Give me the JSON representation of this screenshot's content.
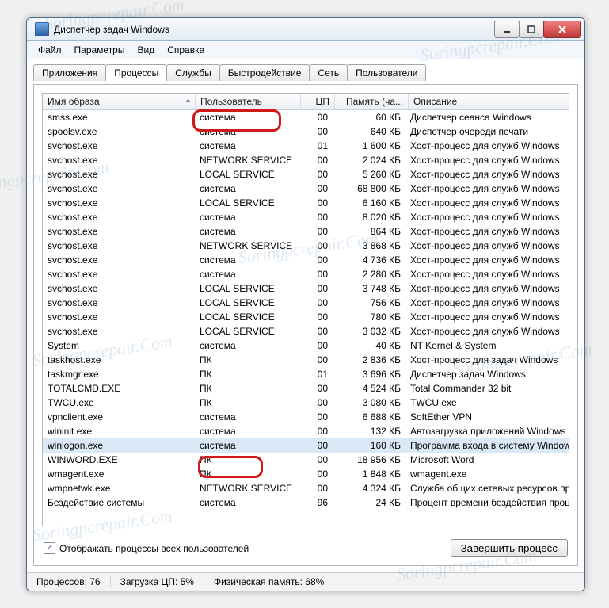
{
  "window": {
    "title": "Диспетчер задач Windows"
  },
  "menu": [
    "Файл",
    "Параметры",
    "Вид",
    "Справка"
  ],
  "tabs": [
    "Приложения",
    "Процессы",
    "Службы",
    "Быстродействие",
    "Сеть",
    "Пользователи"
  ],
  "active_tab": 1,
  "columns": [
    "Имя образа",
    "Пользователь",
    "ЦП",
    "Память (ча...",
    "Описание"
  ],
  "rows": [
    {
      "name": "smss.exe",
      "user": "система",
      "cpu": "00",
      "mem": "60 КБ",
      "desc": "Диспетчер сеанса  Windows"
    },
    {
      "name": "spoolsv.exe",
      "user": "система",
      "cpu": "00",
      "mem": "640 КБ",
      "desc": "Диспетчер очереди печати"
    },
    {
      "name": "svchost.exe",
      "user": "система",
      "cpu": "01",
      "mem": "1 600 КБ",
      "desc": "Хост-процесс для служб Windows"
    },
    {
      "name": "svchost.exe",
      "user": "NETWORK SERVICE",
      "cpu": "00",
      "mem": "2 024 КБ",
      "desc": "Хост-процесс для служб Windows"
    },
    {
      "name": "svchost.exe",
      "user": "LOCAL SERVICE",
      "cpu": "00",
      "mem": "5 260 КБ",
      "desc": "Хост-процесс для служб Windows"
    },
    {
      "name": "svchost.exe",
      "user": "система",
      "cpu": "00",
      "mem": "68 800 КБ",
      "desc": "Хост-процесс для служб Windows"
    },
    {
      "name": "svchost.exe",
      "user": "LOCAL SERVICE",
      "cpu": "00",
      "mem": "6 160 КБ",
      "desc": "Хост-процесс для служб Windows"
    },
    {
      "name": "svchost.exe",
      "user": "система",
      "cpu": "00",
      "mem": "8 020 КБ",
      "desc": "Хост-процесс для служб Windows"
    },
    {
      "name": "svchost.exe",
      "user": "система",
      "cpu": "00",
      "mem": "864 КБ",
      "desc": "Хост-процесс для служб Windows"
    },
    {
      "name": "svchost.exe",
      "user": "NETWORK SERVICE",
      "cpu": "00",
      "mem": "3 868 КБ",
      "desc": "Хост-процесс для служб Windows"
    },
    {
      "name": "svchost.exe",
      "user": "система",
      "cpu": "00",
      "mem": "4 736 КБ",
      "desc": "Хост-процесс для служб Windows"
    },
    {
      "name": "svchost.exe",
      "user": "система",
      "cpu": "00",
      "mem": "2 280 КБ",
      "desc": "Хост-процесс для служб Windows"
    },
    {
      "name": "svchost.exe",
      "user": "LOCAL SERVICE",
      "cpu": "00",
      "mem": "3 748 КБ",
      "desc": "Хост-процесс для служб Windows"
    },
    {
      "name": "svchost.exe",
      "user": "LOCAL SERVICE",
      "cpu": "00",
      "mem": "756 КБ",
      "desc": "Хост-процесс для служб Windows"
    },
    {
      "name": "svchost.exe",
      "user": "LOCAL SERVICE",
      "cpu": "00",
      "mem": "780 КБ",
      "desc": "Хост-процесс для служб Windows"
    },
    {
      "name": "svchost.exe",
      "user": "LOCAL SERVICE",
      "cpu": "00",
      "mem": "3 032 КБ",
      "desc": "Хост-процесс для служб Windows"
    },
    {
      "name": "System",
      "user": "система",
      "cpu": "00",
      "mem": "40 КБ",
      "desc": "NT Kernel & System"
    },
    {
      "name": "taskhost.exe",
      "user": "ПК",
      "cpu": "00",
      "mem": "2 836 КБ",
      "desc": "Хост-процесс для задач Windows"
    },
    {
      "name": "taskmgr.exe",
      "user": "ПК",
      "cpu": "01",
      "mem": "3 696 КБ",
      "desc": "Диспетчер задач Windows"
    },
    {
      "name": "TOTALCMD.EXE",
      "user": "ПК",
      "cpu": "00",
      "mem": "4 524 КБ",
      "desc": "Total Commander 32 bit"
    },
    {
      "name": "TWCU.exe",
      "user": "ПК",
      "cpu": "00",
      "mem": "3 080 КБ",
      "desc": "TWCU.exe"
    },
    {
      "name": "vpnclient.exe",
      "user": "система",
      "cpu": "00",
      "mem": "6 688 КБ",
      "desc": "SoftEther VPN"
    },
    {
      "name": "wininit.exe",
      "user": "система",
      "cpu": "00",
      "mem": "132 КБ",
      "desc": "Автозагрузка приложений Windows"
    },
    {
      "name": "winlogon.exe",
      "user": "система",
      "cpu": "00",
      "mem": "160 КБ",
      "desc": "Программа входа в систему Windows",
      "selected": true
    },
    {
      "name": "WINWORD.EXE",
      "user": "ПК",
      "cpu": "00",
      "mem": "18 956 КБ",
      "desc": "Microsoft Word"
    },
    {
      "name": "wmagent.exe",
      "user": "ПК",
      "cpu": "00",
      "mem": "1 848 КБ",
      "desc": "wmagent.exe"
    },
    {
      "name": "wmpnetwk.exe",
      "user": "NETWORK SERVICE",
      "cpu": "00",
      "mem": "4 324 КБ",
      "desc": "Служба общих сетевых ресурсов проиг..."
    },
    {
      "name": "Бездействие системы",
      "user": "система",
      "cpu": "96",
      "mem": "24 КБ",
      "desc": "Процент времени бездействия процессора"
    }
  ],
  "checkbox": {
    "checked": true,
    "label": "Отображать процессы всех пользователей"
  },
  "end_button": "Завершить процесс",
  "status": {
    "processes_label": "Процессов: 76",
    "cpu_label": "Загрузка ЦП: 5%",
    "mem_label": "Физическая память: 68%"
  },
  "watermark": "Soringpcrepair.Com"
}
